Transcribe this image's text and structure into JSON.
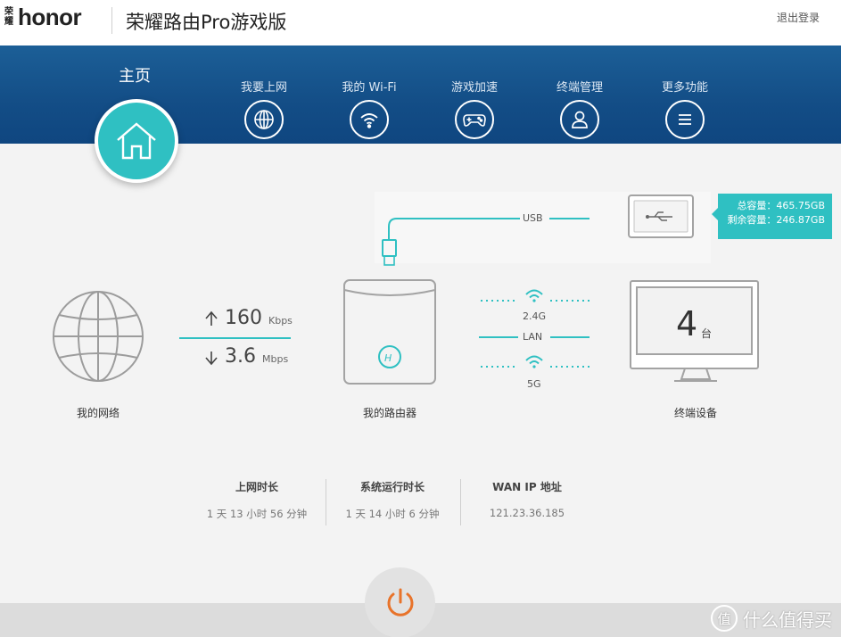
{
  "header": {
    "brand_small": "荣耀",
    "logo": "honor",
    "title": "荣耀路由Pro游戏版",
    "logout_label": "退出登录"
  },
  "nav": {
    "home_label": "主页",
    "items": [
      {
        "label": "我要上网",
        "icon": "globe-icon"
      },
      {
        "label": "我的 Wi-Fi",
        "icon": "wifi-icon"
      },
      {
        "label": "游戏加速",
        "icon": "gamepad-icon"
      },
      {
        "label": "终端管理",
        "icon": "user-icon"
      },
      {
        "label": "更多功能",
        "icon": "menu-icon"
      }
    ]
  },
  "network": {
    "label": "我的网络",
    "upload_value": "160",
    "upload_unit": "Kbps",
    "download_value": "3.6",
    "download_unit": "Mbps"
  },
  "router": {
    "label": "我的路由器",
    "usb_label": "USB",
    "band_24": "2.4G",
    "lan_label": "LAN",
    "band_5": "5G"
  },
  "storage": {
    "total": "总容量：465.75GB",
    "free": "剩余容量：246.87GB"
  },
  "devices": {
    "label": "终端设备",
    "count": "4",
    "unit": "台"
  },
  "stats": [
    {
      "title": "上网时长",
      "value": "1 天 13 小时 56 分钟"
    },
    {
      "title": "系统运行时长",
      "value": "1 天 14 小时 6 分钟"
    },
    {
      "title": "WAN IP 地址",
      "value": "121.23.36.185"
    }
  ],
  "watermark": {
    "text": "什么值得买",
    "symbol": "值"
  },
  "colors": {
    "accent": "#2fc0c2",
    "nav_blue": "#15508a",
    "power": "#e8732a"
  }
}
